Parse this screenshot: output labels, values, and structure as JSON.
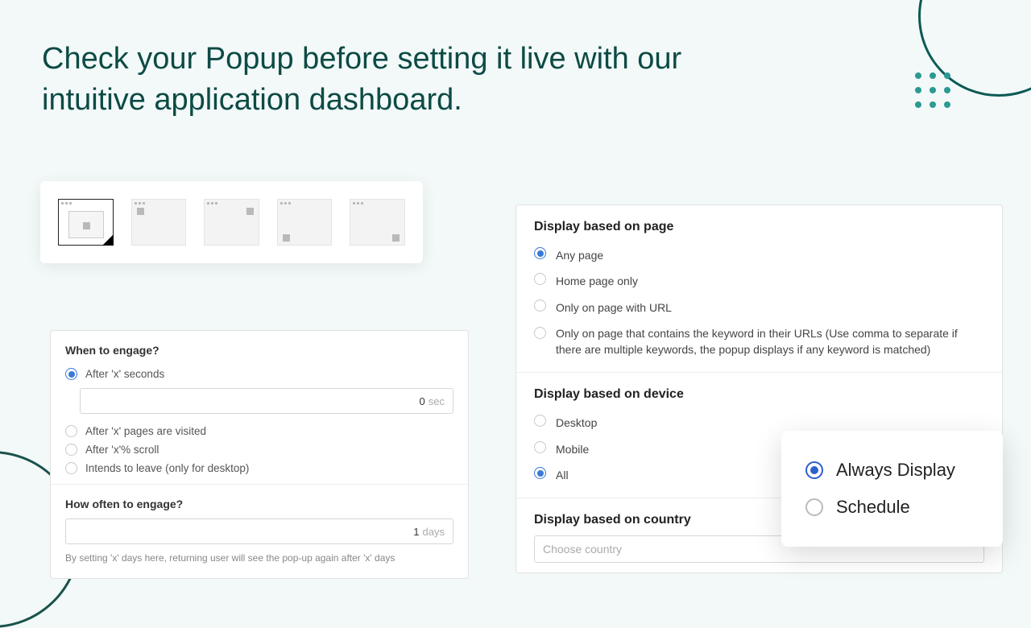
{
  "headline": "Check your Popup before setting it live with our intuitive application dashboard.",
  "engage": {
    "when_title": "When to engage?",
    "after_seconds": "After 'x' seconds",
    "seconds_value": "0",
    "seconds_unit": "sec",
    "after_pages": "After 'x' pages are visited",
    "after_scroll": "After 'x'% scroll",
    "intends_leave": "Intends to leave (only for desktop)",
    "often_title": "How often to engage?",
    "days_value": "1",
    "days_unit": "days",
    "often_help": "By setting 'x' days here, returning user will see the pop-up again after 'x' days"
  },
  "display": {
    "page_title": "Display based on page",
    "page_any": "Any page",
    "page_home": "Home page only",
    "page_url": "Only on page with URL",
    "page_keyword": "Only on page that contains the keyword in their URLs (Use comma to separate if there are multiple keywords, the popup displays if any keyword is matched)",
    "device_title": "Display based on device",
    "device_desktop": "Desktop",
    "device_mobile": "Mobile",
    "device_all": "All",
    "country_title": "Display based on country",
    "country_placeholder": "Choose country"
  },
  "schedule": {
    "always": "Always Display",
    "schedule": "Schedule"
  }
}
